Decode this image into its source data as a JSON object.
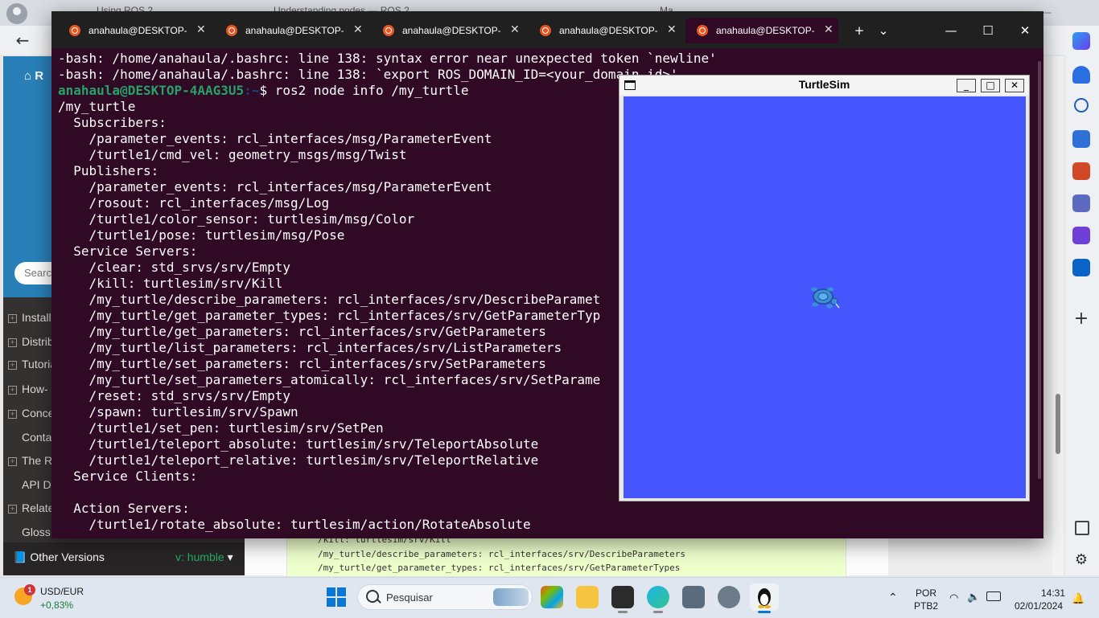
{
  "browser": {
    "tabs_ghost": [
      "Using ROS 2 ...",
      "Understanding nodes — ROS 2 ...",
      "  ...",
      "Ma..."
    ],
    "back_glyph": "←"
  },
  "docs": {
    "brand": "R",
    "search_placeholder": "Search",
    "nav_items": [
      "Install",
      "Distrib",
      "Tutoria",
      "How-",
      "Conce",
      "Conta",
      "The R",
      "API D",
      "Relate",
      "Gloss"
    ],
    "other_versions_label": "Other Versions",
    "version_label": "v: humble",
    "code_lines": [
      "/kill: turtlesim/srv/Kill",
      "/my_turtle/describe_parameters: rcl_interfaces/srv/DescribeParameters",
      "/my_turtle/get_parameter_types: rcl_interfaces/srv/GetParameterTypes"
    ]
  },
  "terminal": {
    "tabs": [
      {
        "title": "anahaula@DESKTOP-4",
        "active": false
      },
      {
        "title": "anahaula@DESKTOP-4",
        "active": false
      },
      {
        "title": "anahaula@DESKTOP-4",
        "active": false
      },
      {
        "title": "anahaula@DESKTOP-4",
        "active": false
      },
      {
        "title": "anahaula@DESKTOP-",
        "active": true
      }
    ],
    "new_tab": "+",
    "dropdown": "⌄",
    "minimize": "—",
    "maximize": "☐",
    "close": "✕",
    "prompt_user": "anahaula@DESKTOP-4AAG3U5",
    "prompt_path": ":~",
    "prompt_symbol": "$ ",
    "command": "ros2 node info /my_turtle",
    "error_lines": [
      "-bash: /home/anahaula/.bashrc: line 138: syntax error near unexpected token `newline'",
      "-bash: /home/anahaula/.bashrc: line 138: `export ROS_DOMAIN_ID=<your_domain_id>'"
    ],
    "output_lines": [
      "/my_turtle",
      "  Subscribers:",
      "    /parameter_events: rcl_interfaces/msg/ParameterEvent",
      "    /turtle1/cmd_vel: geometry_msgs/msg/Twist",
      "  Publishers:",
      "    /parameter_events: rcl_interfaces/msg/ParameterEvent",
      "    /rosout: rcl_interfaces/msg/Log",
      "    /turtle1/color_sensor: turtlesim/msg/Color",
      "    /turtle1/pose: turtlesim/msg/Pose",
      "  Service Servers:",
      "    /clear: std_srvs/srv/Empty",
      "    /kill: turtlesim/srv/Kill",
      "    /my_turtle/describe_parameters: rcl_interfaces/srv/DescribeParamet",
      "    /my_turtle/get_parameter_types: rcl_interfaces/srv/GetParameterTyp",
      "    /my_turtle/get_parameters: rcl_interfaces/srv/GetParameters",
      "    /my_turtle/list_parameters: rcl_interfaces/srv/ListParameters",
      "    /my_turtle/set_parameters: rcl_interfaces/srv/SetParameters",
      "    /my_turtle/set_parameters_atomically: rcl_interfaces/srv/SetParame",
      "    /reset: std_srvs/srv/Empty",
      "    /spawn: turtlesim/srv/Spawn",
      "    /turtle1/set_pen: turtlesim/srv/SetPen",
      "    /turtle1/teleport_absolute: turtlesim/srv/TeleportAbsolute",
      "    /turtle1/teleport_relative: turtlesim/srv/TeleportRelative",
      "  Service Clients:",
      "",
      "  Action Servers:",
      "    /turtle1/rotate_absolute: turtlesim/action/RotateAbsolute"
    ]
  },
  "turtlesim": {
    "title": "TurtleSim",
    "minimize": "_",
    "maximize": "□",
    "close": "✕",
    "background_color": "#4556ff",
    "turtle_color": "#3b8fd9"
  },
  "taskbar": {
    "weather_badge": "1",
    "ticker_label": "USD/EUR",
    "ticker_change": "+0,83%",
    "search_placeholder": "Pesquisar",
    "language": "POR",
    "layout": "PTB2",
    "time": "14:31",
    "date": "02/01/2024"
  },
  "colors": {
    "terminal_bg": "#300a24",
    "prompt_user": "#26a269",
    "prompt_path": "#12488b",
    "docs_brand": "#2980b9"
  }
}
